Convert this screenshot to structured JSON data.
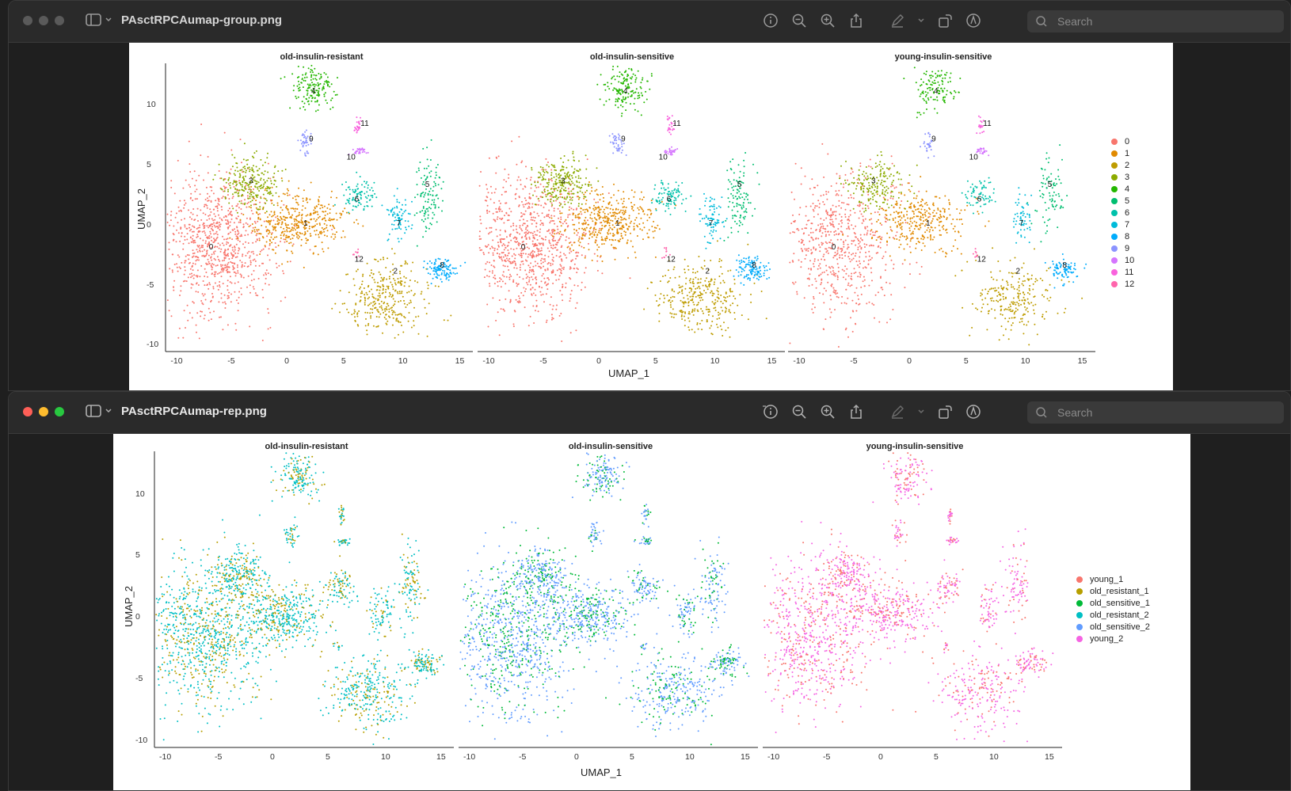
{
  "windows": [
    {
      "title": "PAsctRPCAumap-group.png",
      "search_placeholder": "Search",
      "panels": [
        "old-insulin-resistant",
        "old-insulin-sensitive",
        "young-insulin-sensitive"
      ],
      "xlabel": "UMAP_1",
      "ylabel": "UMAP_2",
      "xticks": [
        "-10",
        "-5",
        "0",
        "5",
        "10",
        "15"
      ],
      "yticks": [
        "10",
        "5",
        "0",
        "-5",
        "-10"
      ],
      "legend": [
        {
          "label": "0",
          "color": "#F8766D"
        },
        {
          "label": "1",
          "color": "#E18A00"
        },
        {
          "label": "2",
          "color": "#BE9C00"
        },
        {
          "label": "3",
          "color": "#8CAB00"
        },
        {
          "label": "4",
          "color": "#24B700"
        },
        {
          "label": "5",
          "color": "#00BE70"
        },
        {
          "label": "6",
          "color": "#00C1AB"
        },
        {
          "label": "7",
          "color": "#00BBDA"
        },
        {
          "label": "8",
          "color": "#00ACFC"
        },
        {
          "label": "9",
          "color": "#8B93FF"
        },
        {
          "label": "10",
          "color": "#D575FE"
        },
        {
          "label": "11",
          "color": "#F962DD"
        },
        {
          "label": "12",
          "color": "#FF65AC"
        }
      ]
    },
    {
      "title": "PAsctRPCAumap-rep.png",
      "search_placeholder": "Search",
      "panels": [
        "old-insulin-resistant",
        "old-insulin-sensitive",
        "young-insulin-sensitive"
      ],
      "xlabel": "UMAP_1",
      "ylabel": "UMAP_2",
      "xticks": [
        "-10",
        "-5",
        "0",
        "5",
        "10",
        "15"
      ],
      "yticks": [
        "10",
        "5",
        "0",
        "-5",
        "-10"
      ],
      "legend": [
        {
          "label": "young_1",
          "color": "#F8766D"
        },
        {
          "label": "old_resistant_1",
          "color": "#B79F00"
        },
        {
          "label": "old_sensitive_1",
          "color": "#00BA38"
        },
        {
          "label": "old_resistant_2",
          "color": "#00BFC4"
        },
        {
          "label": "old_sensitive_2",
          "color": "#619CFF"
        },
        {
          "label": "young_2",
          "color": "#F564E3"
        }
      ]
    }
  ],
  "chart_data": [
    {
      "type": "scatter",
      "xlabel": "UMAP_1",
      "ylabel": "UMAP_2",
      "xlim": [
        -11,
        16
      ],
      "ylim": [
        -10.5,
        13.5
      ],
      "facets": [
        "old-insulin-resistant",
        "old-insulin-sensitive",
        "young-insulin-sensitive"
      ],
      "cluster_labels": [
        {
          "label": "0",
          "x": -7,
          "y": -2
        },
        {
          "label": "1",
          "x": 1.3,
          "y": 0
        },
        {
          "label": "2",
          "x": 9.2,
          "y": -4
        },
        {
          "label": "3",
          "x": -3.5,
          "y": 3.5
        },
        {
          "label": "4",
          "x": 2,
          "y": 11
        },
        {
          "label": "5",
          "x": 12,
          "y": 3.2
        },
        {
          "label": "6",
          "x": 5.8,
          "y": 2
        },
        {
          "label": "7",
          "x": 9.5,
          "y": 0
        },
        {
          "label": "8",
          "x": 13.3,
          "y": -3.5
        },
        {
          "label": "9",
          "x": 1.8,
          "y": 7
        },
        {
          "label": "10",
          "x": 5.3,
          "y": 5.5
        },
        {
          "label": "11",
          "x": 6.5,
          "y": 8.3
        },
        {
          "label": "12",
          "x": 6,
          "y": -3
        }
      ],
      "clusters": [
        {
          "label": "0",
          "cx": -6.5,
          "cy": -1.5,
          "sx": 2.6,
          "sy": 3.0,
          "n": 900
        },
        {
          "label": "1",
          "cx": 0.5,
          "cy": 0.3,
          "sx": 2.0,
          "sy": 1.2,
          "n": 420
        },
        {
          "label": "2",
          "cx": 8.5,
          "cy": -6,
          "sx": 1.9,
          "sy": 1.5,
          "n": 320
        },
        {
          "label": "3",
          "cx": -3.5,
          "cy": 3.5,
          "sx": 1.2,
          "sy": 1.0,
          "n": 240
        },
        {
          "label": "4",
          "cx": 2,
          "cy": 11.5,
          "sx": 0.9,
          "sy": 0.9,
          "n": 160
        },
        {
          "label": "5",
          "cx": 12,
          "cy": 2.5,
          "sx": 0.6,
          "sy": 1.6,
          "n": 110
        },
        {
          "label": "6",
          "cx": 5.8,
          "cy": 2.5,
          "sx": 0.7,
          "sy": 0.7,
          "n": 90
        },
        {
          "label": "7",
          "cx": 9.5,
          "cy": 0.5,
          "sx": 0.5,
          "sy": 1.0,
          "n": 80
        },
        {
          "label": "8",
          "cx": 13.2,
          "cy": -3.7,
          "sx": 0.7,
          "sy": 0.5,
          "n": 110
        },
        {
          "label": "9",
          "cx": 1.3,
          "cy": 6.8,
          "sx": 0.25,
          "sy": 0.5,
          "n": 40
        },
        {
          "label": "10",
          "cx": 6,
          "cy": 6.2,
          "sx": 0.3,
          "sy": 0.15,
          "n": 30
        },
        {
          "label": "11",
          "cx": 5.9,
          "cy": 8.3,
          "sx": 0.15,
          "sy": 0.4,
          "n": 25
        },
        {
          "label": "12",
          "cx": 5.6,
          "cy": -2.3,
          "sx": 0.2,
          "sy": 0.2,
          "n": 10
        }
      ]
    },
    {
      "type": "scatter",
      "xlabel": "UMAP_1",
      "ylabel": "UMAP_2",
      "xlim": [
        -11,
        16
      ],
      "ylim": [
        -10.5,
        13.5
      ],
      "facets": [
        "old-insulin-resistant",
        "old-insulin-sensitive",
        "young-insulin-sensitive"
      ],
      "facet_series": [
        [
          "old_resistant_2",
          "old_resistant_1"
        ],
        [
          "old_sensitive_2",
          "old_sensitive_1"
        ],
        [
          "young_2",
          "young_1"
        ]
      ]
    }
  ]
}
